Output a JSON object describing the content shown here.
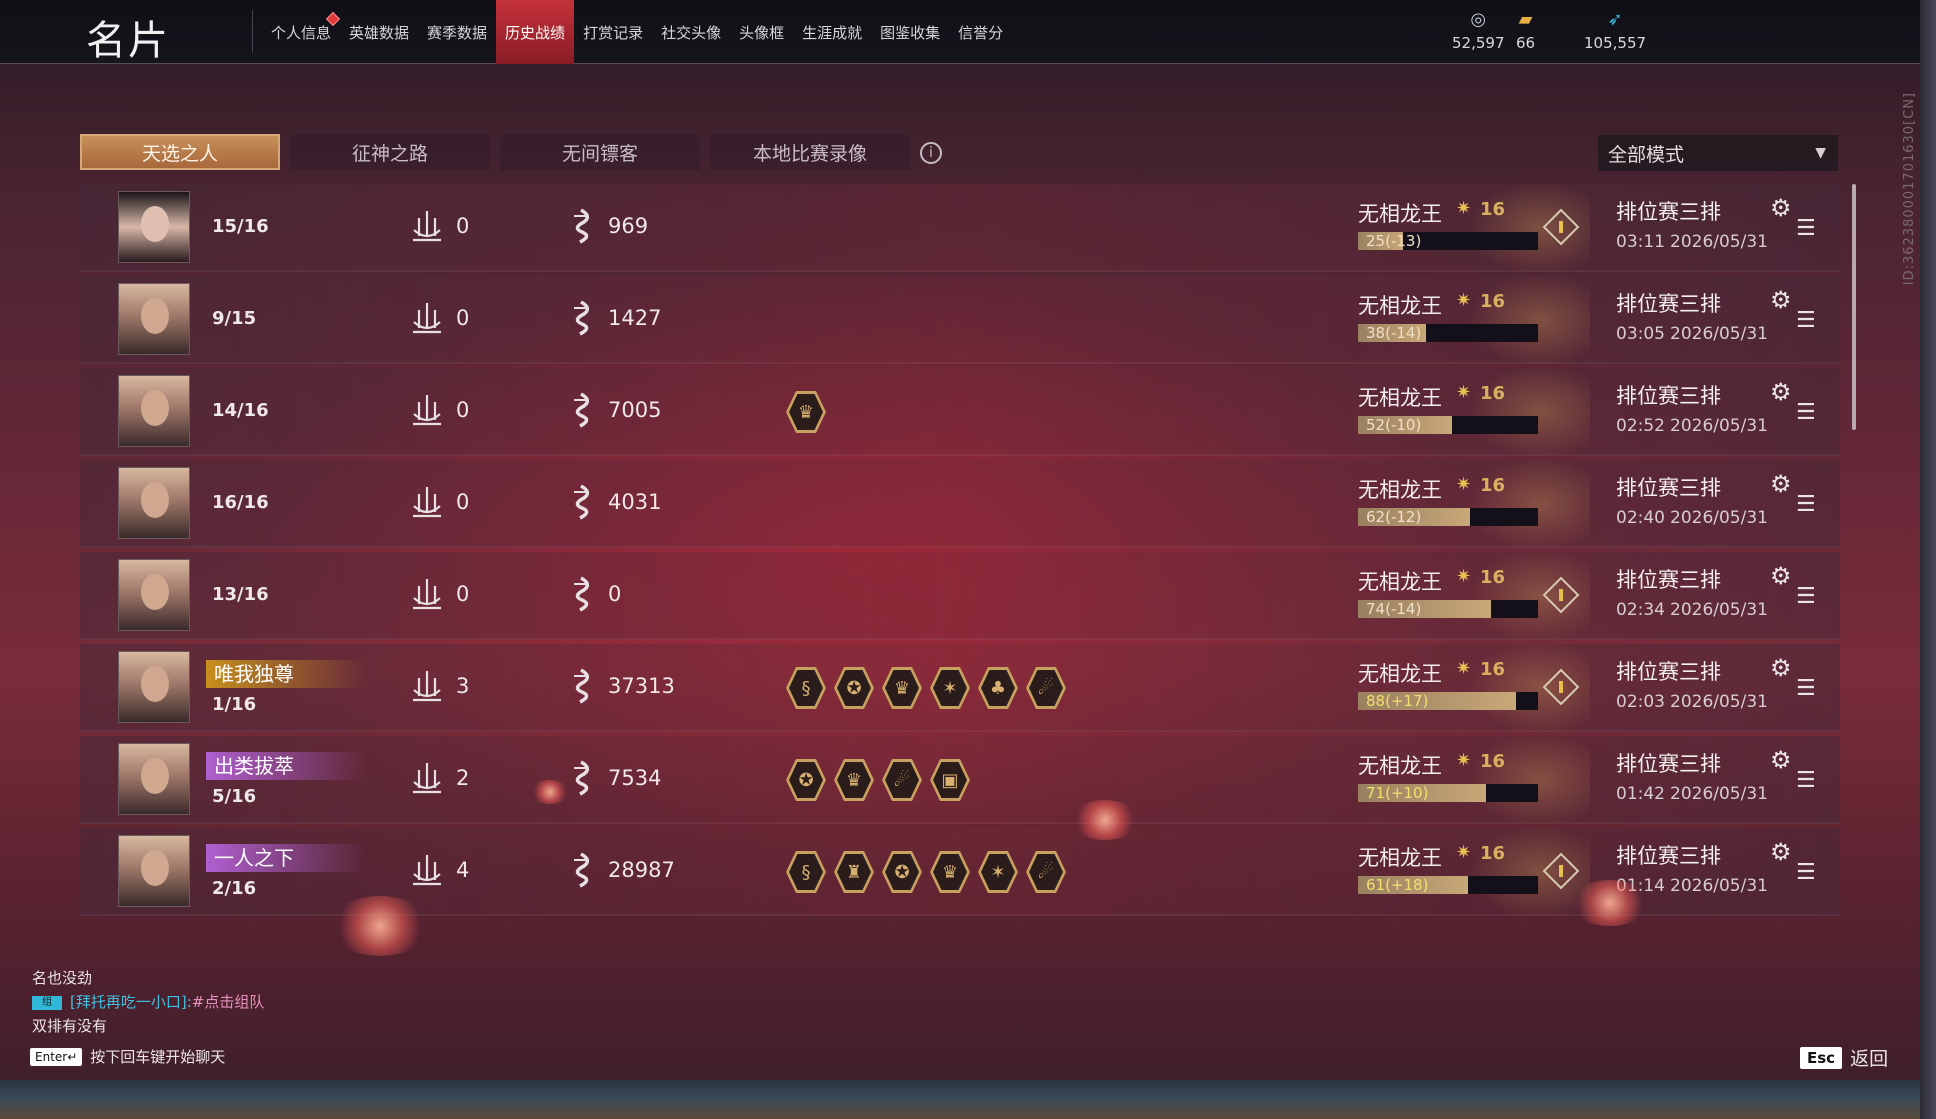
{
  "header": {
    "title": "名片",
    "tabs": [
      {
        "label": "个人信息",
        "active": false,
        "notify": true
      },
      {
        "label": "英雄数据",
        "active": false
      },
      {
        "label": "赛季数据",
        "active": false
      },
      {
        "label": "历史战绩",
        "active": true
      },
      {
        "label": "打赏记录",
        "active": false
      },
      {
        "label": "社交头像",
        "active": false
      },
      {
        "label": "头像框",
        "active": false
      },
      {
        "label": "生涯成就",
        "active": false
      },
      {
        "label": "图鉴收集",
        "active": false
      },
      {
        "label": "信誉分",
        "active": false
      }
    ],
    "currencies": [
      {
        "icon": "coin-icon",
        "value": "52,597"
      },
      {
        "icon": "gold-ingot-icon",
        "value": "66"
      },
      {
        "icon": "feather-icon",
        "value": "105,557"
      }
    ]
  },
  "side_id": "ID:362380001701630[CN]",
  "subtabs": [
    {
      "label": "天选之人",
      "active": true
    },
    {
      "label": "征神之路",
      "active": false
    },
    {
      "label": "无间镖客",
      "active": false
    },
    {
      "label": "本地比赛录像",
      "active": false
    }
  ],
  "mode_filter": {
    "selected": "全部模式"
  },
  "matches": [
    {
      "avatar": "female",
      "title": "",
      "title_style": "",
      "place": "15/16",
      "kills": "0",
      "damage": "969",
      "medals": [],
      "rank": "无相龙王",
      "level": "16",
      "rank_change": "25(-13)",
      "progress": 0.25,
      "up": false,
      "mvp": true,
      "type": "排位赛三排",
      "time": "03:11",
      "date": "2026/05/31"
    },
    {
      "avatar": "male",
      "title": "",
      "title_style": "",
      "place": "9/15",
      "kills": "0",
      "damage": "1427",
      "medals": [],
      "rank": "无相龙王",
      "level": "16",
      "rank_change": "38(-14)",
      "progress": 0.38,
      "up": false,
      "mvp": false,
      "type": "排位赛三排",
      "time": "03:05",
      "date": "2026/05/31"
    },
    {
      "avatar": "male",
      "title": "",
      "title_style": "",
      "place": "14/16",
      "kills": "0",
      "damage": "7005",
      "medals": [
        "♛"
      ],
      "rank": "无相龙王",
      "level": "16",
      "rank_change": "52(-10)",
      "progress": 0.52,
      "up": false,
      "mvp": false,
      "type": "排位赛三排",
      "time": "02:52",
      "date": "2026/05/31"
    },
    {
      "avatar": "male",
      "title": "",
      "title_style": "",
      "place": "16/16",
      "kills": "0",
      "damage": "4031",
      "medals": [],
      "rank": "无相龙王",
      "level": "16",
      "rank_change": "62(-12)",
      "progress": 0.62,
      "up": false,
      "mvp": false,
      "type": "排位赛三排",
      "time": "02:40",
      "date": "2026/05/31"
    },
    {
      "avatar": "male",
      "title": "",
      "title_style": "",
      "place": "13/16",
      "kills": "0",
      "damage": "0",
      "medals": [],
      "rank": "无相龙王",
      "level": "16",
      "rank_change": "74(-14)",
      "progress": 0.74,
      "up": false,
      "mvp": true,
      "type": "排位赛三排",
      "time": "02:34",
      "date": "2026/05/31"
    },
    {
      "avatar": "male",
      "title": "唯我独尊",
      "title_style": "gold",
      "place": "1/16",
      "kills": "3",
      "damage": "37313",
      "medals": [
        "§",
        "✪",
        "♛",
        "✶",
        "♣",
        "☄"
      ],
      "rank": "无相龙王",
      "level": "16",
      "rank_change": "88(+17)",
      "progress": 0.88,
      "up": true,
      "mvp": true,
      "type": "排位赛三排",
      "time": "02:03",
      "date": "2026/05/31"
    },
    {
      "avatar": "male",
      "title": "出类拔萃",
      "title_style": "purple",
      "place": "5/16",
      "kills": "2",
      "damage": "7534",
      "medals": [
        "✪",
        "♛",
        "☄",
        "▣"
      ],
      "rank": "无相龙王",
      "level": "16",
      "rank_change": "71(+10)",
      "progress": 0.71,
      "up": true,
      "mvp": false,
      "type": "排位赛三排",
      "time": "01:42",
      "date": "2026/05/31"
    },
    {
      "avatar": "male",
      "title": "一人之下",
      "title_style": "purple",
      "place": "2/16",
      "kills": "4",
      "damage": "28987",
      "medals": [
        "§",
        "♜",
        "✪",
        "♛",
        "✶",
        "☄"
      ],
      "rank": "无相龙王",
      "level": "16",
      "rank_change": "61(+18)",
      "progress": 0.61,
      "up": true,
      "mvp": true,
      "type": "排位赛三排",
      "time": "01:14",
      "date": "2026/05/31"
    }
  ],
  "chat": {
    "lines": [
      {
        "text": "名也没劲"
      },
      {
        "tag": "组",
        "link": "[拜托再吃一小口]:",
        "click": "#点击组队"
      },
      {
        "text": "双排有没有"
      }
    ],
    "enter_key": "Enter↵",
    "enter_hint": "按下回车键开始聊天"
  },
  "footer": {
    "esc_key": "Esc",
    "back_label": "返回"
  },
  "colors": {
    "accent_red": "#c4323a",
    "subtab_active": "#c8905a",
    "title_gold": "#c8901e",
    "title_purple": "#b060d0"
  }
}
